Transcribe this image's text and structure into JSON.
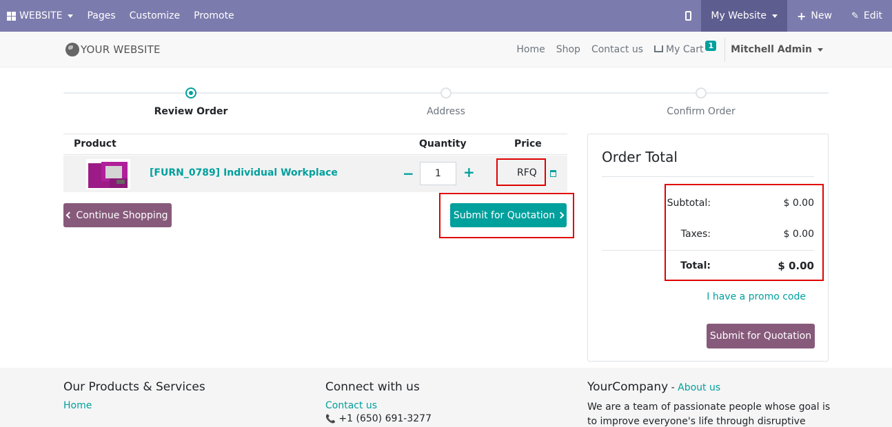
{
  "adminbar": {
    "website_label": "WEBSITE",
    "pages": "Pages",
    "customize": "Customize",
    "promote": "Promote",
    "my_website": "My Website",
    "new": "New",
    "edit": "Edit"
  },
  "header": {
    "logo": "YOUR WEBSITE",
    "nav": [
      "Home",
      "Shop",
      "Contact us"
    ],
    "cart_label": "My Cart",
    "cart_count": "1",
    "user": "Mitchell Admin"
  },
  "steps": [
    "Review Order",
    "Address",
    "Confirm Order"
  ],
  "cart": {
    "headers": {
      "product": "Product",
      "quantity": "Quantity",
      "price": "Price"
    },
    "row": {
      "name": "[FURN_0789] Individual Workplace",
      "quantity": "1",
      "minus": "−",
      "plus": "+",
      "price": "RFQ"
    },
    "continue_label": "Continue Shopping",
    "submit_label": "Submit for Quotation"
  },
  "order_total": {
    "title": "Order Total",
    "subtotal_label": "Subtotal:",
    "subtotal_value": "$ 0.00",
    "taxes_label": "Taxes:",
    "taxes_value": "$ 0.00",
    "total_label": "Total:",
    "total_value": "$ 0.00",
    "promo": "I have a promo code",
    "submit_label": "Submit for Quotation"
  },
  "footer": {
    "col1_title": "Our Products & Services",
    "col1_link": "Home",
    "col2_title": "Connect with us",
    "col2_link": "Contact us",
    "col2_phone": "+1 (650) 691-3277",
    "col3_title": "YourCompany",
    "col3_dash": " - ",
    "col3_link": "About us",
    "col3_text": "We are a team of passionate people whose goal is to improve everyone's life through disruptive products. We"
  },
  "colors": {
    "admin_bar": "#7c7bad",
    "primary": "#00a09d",
    "secondary": "#875a7b",
    "highlight": "#e00000"
  }
}
